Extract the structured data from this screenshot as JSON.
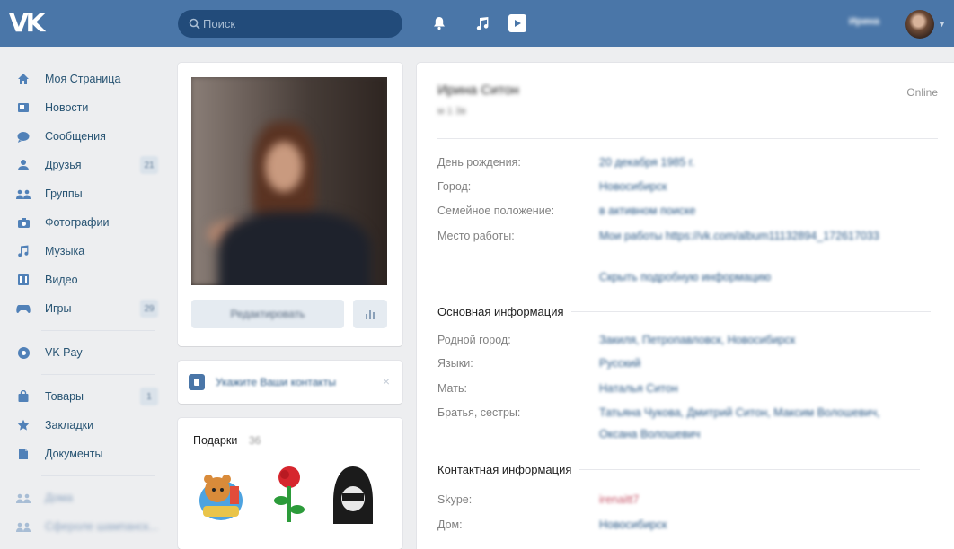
{
  "header": {
    "logo": "VK",
    "search_placeholder": "Поиск",
    "user_name": "Ирина",
    "colors": {
      "bar": "#4a76a8",
      "search_bg": "#224b7a"
    }
  },
  "menu": {
    "items": [
      {
        "label": "Моя Страница",
        "icon": "home-icon"
      },
      {
        "label": "Новости",
        "icon": "news-icon"
      },
      {
        "label": "Сообщения",
        "icon": "messages-icon"
      },
      {
        "label": "Друзья",
        "icon": "friends-icon",
        "count": "21"
      },
      {
        "label": "Группы",
        "icon": "groups-icon"
      },
      {
        "label": "Фотографии",
        "icon": "camera-icon"
      },
      {
        "label": "Музыка",
        "icon": "music-icon"
      },
      {
        "label": "Видео",
        "icon": "video-icon"
      },
      {
        "label": "Игры",
        "icon": "games-icon",
        "count": "29"
      }
    ],
    "vkpay": "VK Pay",
    "items2": [
      {
        "label": "Товары",
        "icon": "bag-icon",
        "count": "1"
      },
      {
        "label": "Закладки",
        "icon": "star-icon"
      },
      {
        "label": "Документы",
        "icon": "document-icon"
      }
    ],
    "groups": [
      "Дома",
      "Сфероле шампанск..."
    ]
  },
  "profile_card": {
    "edit_label": "Редактировать"
  },
  "contact_prompt": {
    "text": "Укажите Ваши контакты",
    "close": "×"
  },
  "gifts": {
    "title": "Подарки",
    "count": "36"
  },
  "info": {
    "name": "Ирина Ситон",
    "status": "м 1 3в",
    "online": "Online",
    "rows": [
      {
        "label": "День рождения:",
        "value": "20 декабря 1985 г."
      },
      {
        "label": "Город:",
        "value": "Новосибирск"
      },
      {
        "label": "Семейное положение:",
        "value": "в активном поиске"
      },
      {
        "label": "Место работы:",
        "value": "Мои работы https://vk.com/album11132894_172617033"
      }
    ],
    "more_link": "Скрыть подробную информацию",
    "basic_title": "Основная информация",
    "basic_rows": [
      {
        "label": "Родной город:",
        "value": "Закиля, Петропавловск, Новосибирск"
      },
      {
        "label": "Языки:",
        "value": "Русский"
      },
      {
        "label": "Мать:",
        "value": "Наталья Ситон"
      },
      {
        "label": "Братья, сестры:",
        "value": "Татьяна Чукова, Дмитрий Ситон, Максим Волошевич,",
        "value2": "Оксана Волошевич"
      }
    ],
    "contact_title": "Контактная информация",
    "contact_rows": [
      {
        "label": "Skype:",
        "value": "irenaitt7"
      },
      {
        "label": "Дом:",
        "value": "Новосибирск"
      }
    ]
  }
}
